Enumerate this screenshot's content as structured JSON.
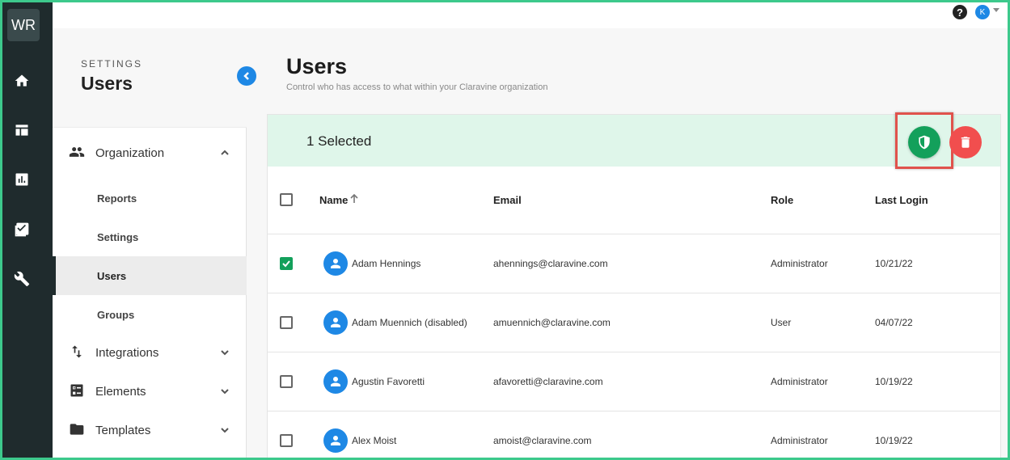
{
  "rail": {
    "logo": "WR",
    "icons": [
      "home-icon",
      "table-icon",
      "chart-icon",
      "checklist-icon",
      "wrench-icon"
    ]
  },
  "topbar": {
    "help": "?",
    "avatar_initial": "K"
  },
  "sidebar": {
    "kicker": "SETTINGS",
    "title": "Users",
    "groups": [
      {
        "label": "Organization",
        "icon": "people-icon",
        "expanded": true
      },
      {
        "label": "Integrations",
        "icon": "swap-vertical-icon",
        "expanded": false
      },
      {
        "label": "Elements",
        "icon": "list-box-icon",
        "expanded": false
      },
      {
        "label": "Templates",
        "icon": "folder-icon",
        "expanded": false
      }
    ],
    "sub_items": [
      "Reports",
      "Settings",
      "Users",
      "Groups"
    ],
    "active_sub": "Users"
  },
  "main": {
    "title": "Users",
    "subtitle": "Control who has access to what within your Claravine organization",
    "selection_text": "1 Selected",
    "columns": [
      "Name",
      "Email",
      "Role",
      "Last Login"
    ],
    "rows": [
      {
        "name": "Adam Hennings",
        "email": "ahennings@claravine.com",
        "role": "Administrator",
        "last_login": "10/21/22",
        "checked": true
      },
      {
        "name": "Adam Muennich (disabled)",
        "email": "amuennich@claravine.com",
        "role": "User",
        "last_login": "04/07/22",
        "checked": false
      },
      {
        "name": "Agustin Favoretti",
        "email": "afavoretti@claravine.com",
        "role": "Administrator",
        "last_login": "10/19/22",
        "checked": false
      },
      {
        "name": "Alex Moist",
        "email": "amoist@claravine.com",
        "role": "Administrator",
        "last_login": "10/19/22",
        "checked": false
      }
    ]
  },
  "colors": {
    "rail": "#1f2b2d",
    "accent_blue": "#1e88e5",
    "success_green": "#13a05b",
    "danger_red": "#f14e4e",
    "selection_bg": "#dff6ea",
    "highlight_box": "#e0524c"
  }
}
